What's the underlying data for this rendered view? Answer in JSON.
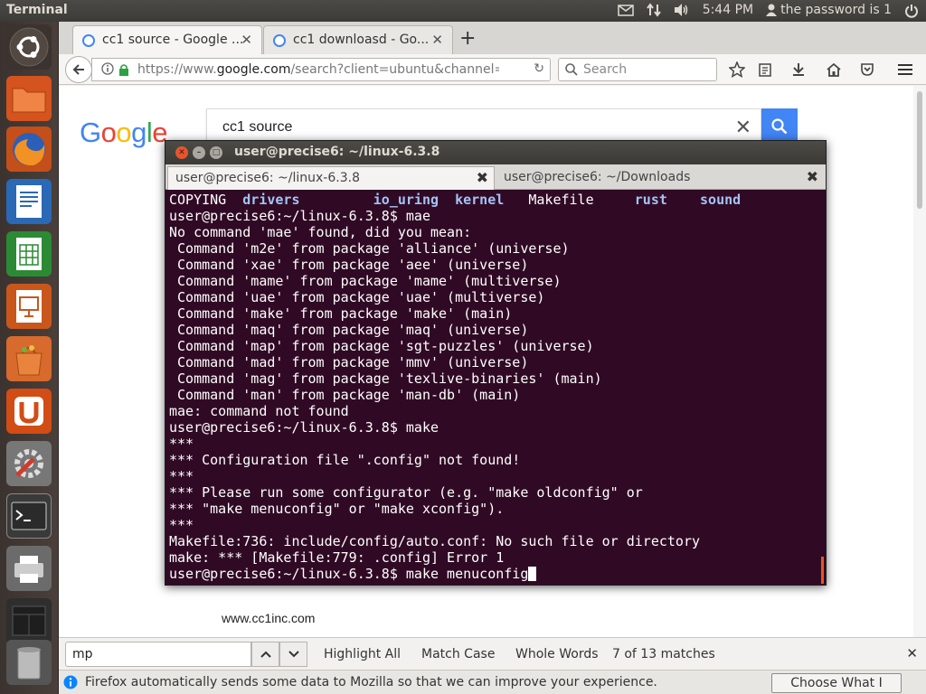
{
  "top_panel": {
    "app_name": "Terminal",
    "time": "5:44 PM",
    "user": "the password is 1"
  },
  "launcher": {
    "items": [
      {
        "icon": "ubuntu-logo-icon"
      },
      {
        "icon": "files-icon"
      },
      {
        "icon": "firefox-icon"
      },
      {
        "icon": "writer-icon"
      },
      {
        "icon": "calc-icon"
      },
      {
        "icon": "impress-icon"
      },
      {
        "icon": "software-center-icon"
      },
      {
        "icon": "ubuntu-one-icon"
      },
      {
        "icon": "system-settings-icon"
      },
      {
        "icon": "terminal-icon"
      },
      {
        "icon": "printer-icon"
      },
      {
        "icon": "workspace-switcher-icon"
      },
      {
        "icon": "trash-icon"
      }
    ]
  },
  "browser": {
    "tabs": [
      {
        "title": "cc1 source - Google ..."
      },
      {
        "title": "cc1 downloasd - Go..."
      }
    ],
    "url_prefix": "https://www.",
    "url_domain": "google.com",
    "url_rest": "/search?client=ubuntu&channel=fs&",
    "search_placeholder": "Search",
    "page": {
      "logo": [
        "G",
        "o",
        "o",
        "g",
        "l",
        "e"
      ],
      "logo_colors": [
        "#4285f4",
        "#ea4335",
        "#fbbc05",
        "#4285f4",
        "#34a853",
        "#ea4335"
      ],
      "query": "cc1 source",
      "footer_site": "www.cc1inc.com"
    },
    "find_bar": {
      "query": "mp",
      "highlight_all": "Highlight All",
      "match_case": "Match Case",
      "whole_words": "Whole Words",
      "matches": "7 of 13 matches"
    },
    "notification": {
      "message": "Firefox automatically sends some data to Mozilla so that we can improve your experience.",
      "button": "Choose What I Share"
    }
  },
  "terminal": {
    "title": "user@precise6: ~/linux-6.3.8",
    "tabs": [
      {
        "title": "user@precise6: ~/linux-6.3.8"
      },
      {
        "title": "user@precise6: ~/Downloads"
      }
    ],
    "listing": [
      {
        "text": "COPYING",
        "dir": false
      },
      {
        "text": "drivers",
        "dir": true
      },
      {
        "text": "io_uring",
        "dir": true
      },
      {
        "text": "kernel",
        "dir": true
      },
      {
        "text": "Makefile",
        "dir": false
      },
      {
        "text": "rust",
        "dir": true
      },
      {
        "text": "sound",
        "dir": true
      }
    ],
    "lines": [
      "user@precise6:~/linux-6.3.8$ mae",
      "No command 'mae' found, did you mean:",
      " Command 'm2e' from package 'alliance' (universe)",
      " Command 'xae' from package 'aee' (universe)",
      " Command 'mame' from package 'mame' (multiverse)",
      " Command 'uae' from package 'uae' (multiverse)",
      " Command 'make' from package 'make' (main)",
      " Command 'maq' from package 'maq' (universe)",
      " Command 'map' from package 'sgt-puzzles' (universe)",
      " Command 'mad' from package 'mmv' (universe)",
      " Command 'mag' from package 'texlive-binaries' (main)",
      " Command 'man' from package 'man-db' (main)",
      "mae: command not found",
      "user@precise6:~/linux-6.3.8$ make",
      "***",
      "*** Configuration file \".config\" not found!",
      "***",
      "*** Please run some configurator (e.g. \"make oldconfig\" or",
      "*** \"make menuconfig\" or \"make xconfig\").",
      "***",
      "Makefile:736: include/config/auto.conf: No such file or directory",
      "make: *** [Makefile:779: .config] Error 1"
    ],
    "prompt": "user@precise6:~/linux-6.3.8$ ",
    "current_input": "make menuconfig"
  }
}
